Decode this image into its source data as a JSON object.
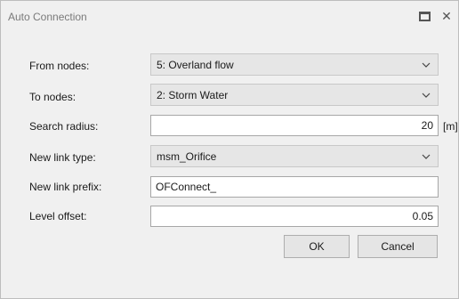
{
  "window": {
    "title": "Auto Connection"
  },
  "form": {
    "from_nodes": {
      "label": "From nodes:",
      "value": "5: Overland flow"
    },
    "to_nodes": {
      "label": "To nodes:",
      "value": "2: Storm Water"
    },
    "search_radius": {
      "label": "Search radius:",
      "value": "20",
      "unit": "[m]"
    },
    "new_link_type": {
      "label": "New link type:",
      "value": "msm_Orifice"
    },
    "new_link_prefix": {
      "label": "New link prefix:",
      "value": "OFConnect_"
    },
    "level_offset": {
      "label": "Level offset:",
      "value": "0.05"
    }
  },
  "buttons": {
    "ok": "OK",
    "cancel": "Cancel"
  },
  "icons": {
    "maximize": "maximize-icon",
    "close": "close-icon",
    "dropdown": "chevron-down-icon"
  },
  "colors": {
    "window_bg": "#f0f0f0",
    "combo_bg": "#e6e6e6",
    "field_bg": "#ffffff"
  }
}
